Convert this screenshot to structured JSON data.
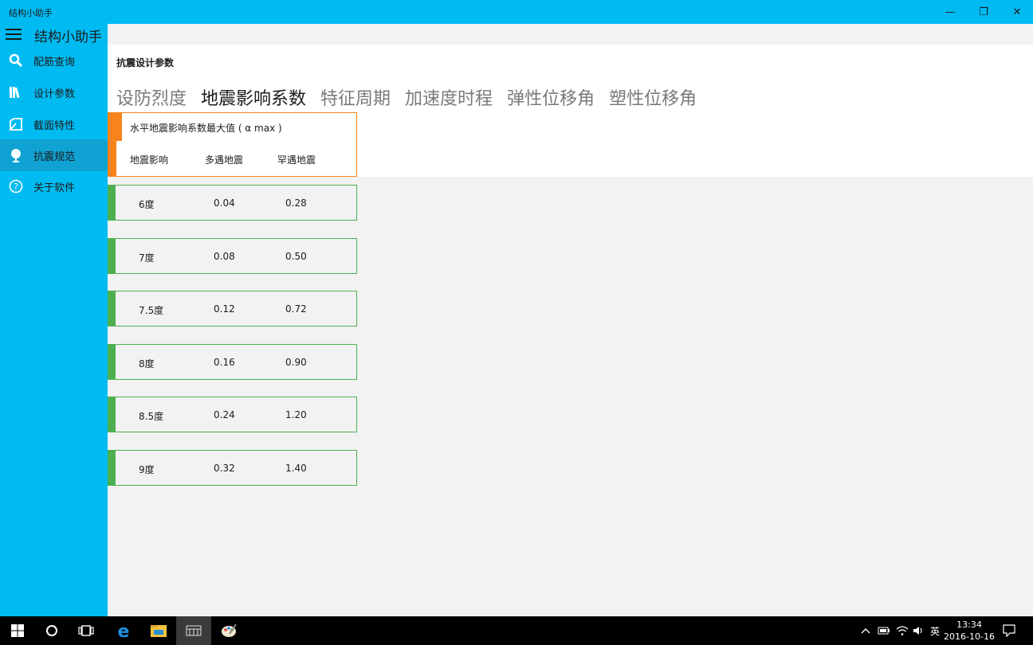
{
  "window": {
    "title": "结构小助手",
    "minimize_glyph": "—",
    "maximize_glyph": "❐",
    "close_glyph": "✕"
  },
  "app": {
    "title": "结构小助手"
  },
  "sidebar": {
    "items": [
      {
        "label": "配筋查询",
        "icon": "search-icon"
      },
      {
        "label": "设计参数",
        "icon": "books-icon"
      },
      {
        "label": "截面特性",
        "icon": "section-icon"
      },
      {
        "label": "抗震规范",
        "icon": "globe-icon",
        "active": true
      },
      {
        "label": "关于软件",
        "icon": "help-icon"
      }
    ]
  },
  "page": {
    "title": "抗震设计参数",
    "tabs": [
      "设防烈度",
      "地震影响系数",
      "特征周期",
      "加速度时程",
      "弹性位移角",
      "塑性位移角"
    ],
    "active_tab": 1
  },
  "table": {
    "caption": "水平地震影响系数最大值 ( α max )",
    "headers": [
      "地震影响",
      "多遇地震",
      "罕遇地震"
    ],
    "rows": [
      [
        "6度",
        "0.04",
        "0.28"
      ],
      [
        "7度",
        "0.08",
        "0.50"
      ],
      [
        "7.5度",
        "0.12",
        "0.72"
      ],
      [
        "8度",
        "0.16",
        "0.90"
      ],
      [
        "8.5度",
        "0.24",
        "1.20"
      ],
      [
        "9度",
        "0.32",
        "1.40"
      ]
    ]
  },
  "taskbar": {
    "apps": [
      "windows-start-icon",
      "cortana-icon",
      "task-view-icon",
      "edge-icon",
      "file-explorer-icon",
      "app-icon",
      "paint-icon"
    ],
    "tray": {
      "ime": "英"
    },
    "time": "13:34",
    "date": "2016-10-16"
  },
  "colors": {
    "accent": "#00bbf2",
    "accent_active": "#0fa2d3",
    "orange": "#f7831c",
    "green": "#4caf50"
  }
}
